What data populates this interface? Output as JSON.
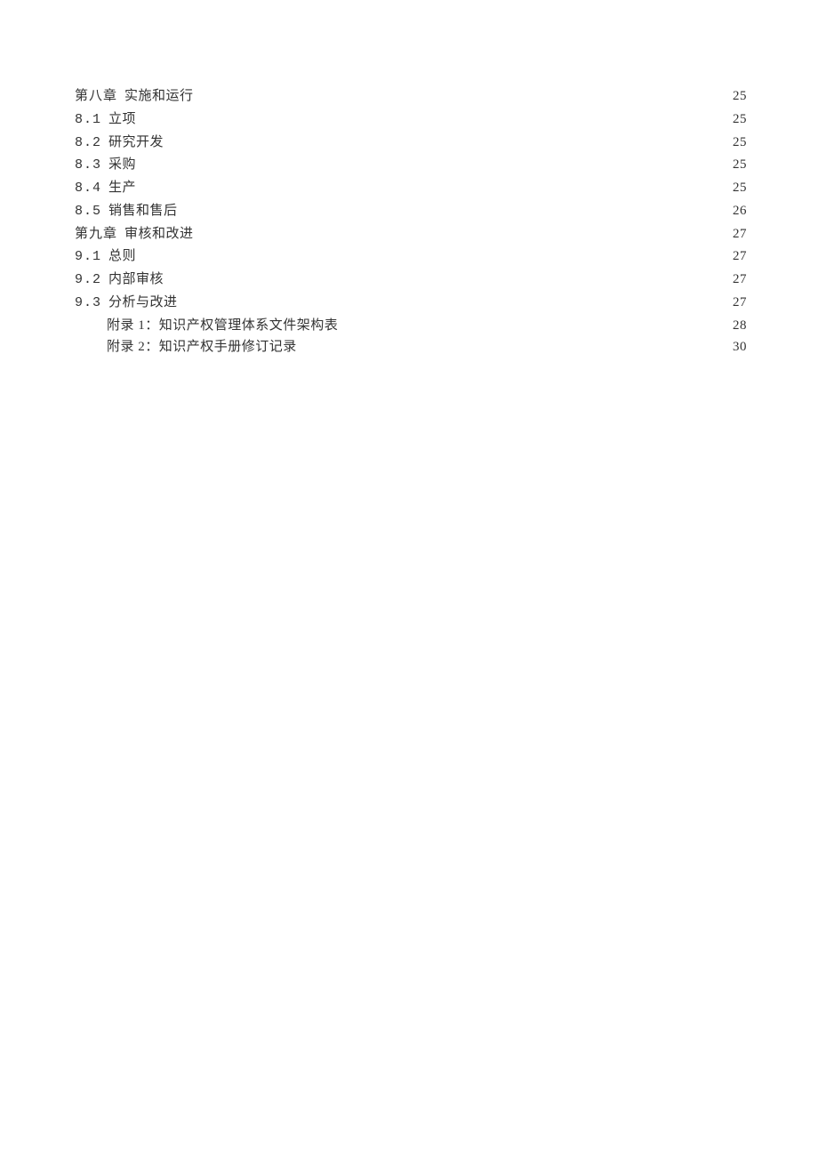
{
  "toc": [
    {
      "indent": "none",
      "number": "第八章",
      "title": "实施和运行",
      "page": "25"
    },
    {
      "indent": "none",
      "number": "8.1",
      "title": "立项",
      "page": "25"
    },
    {
      "indent": "none",
      "number": "8.2",
      "title": "研究开发",
      "page": "25"
    },
    {
      "indent": "none",
      "number": "8.3",
      "title": "采购",
      "page": "25"
    },
    {
      "indent": "none",
      "number": "8.4",
      "title": "生产",
      "page": "25"
    },
    {
      "indent": "none",
      "number": "8.5",
      "title": "销售和售后",
      "page": "26"
    },
    {
      "indent": "none",
      "number": "第九章",
      "title": "审核和改进",
      "page": "27"
    },
    {
      "indent": "none",
      "number": "9.1",
      "title": "总则",
      "page": "27"
    },
    {
      "indent": "none",
      "number": "9.2",
      "title": "内部审核",
      "page": "27"
    },
    {
      "indent": "none",
      "number": "9.3",
      "title": "分析与改进",
      "page": "27"
    },
    {
      "indent": "appendix",
      "number": "",
      "title": "附录 1：知识产权管理体系文件架构表",
      "page": "28"
    },
    {
      "indent": "appendix",
      "number": "",
      "title": "附录 2：知识产权手册修订记录",
      "page": "30"
    }
  ]
}
